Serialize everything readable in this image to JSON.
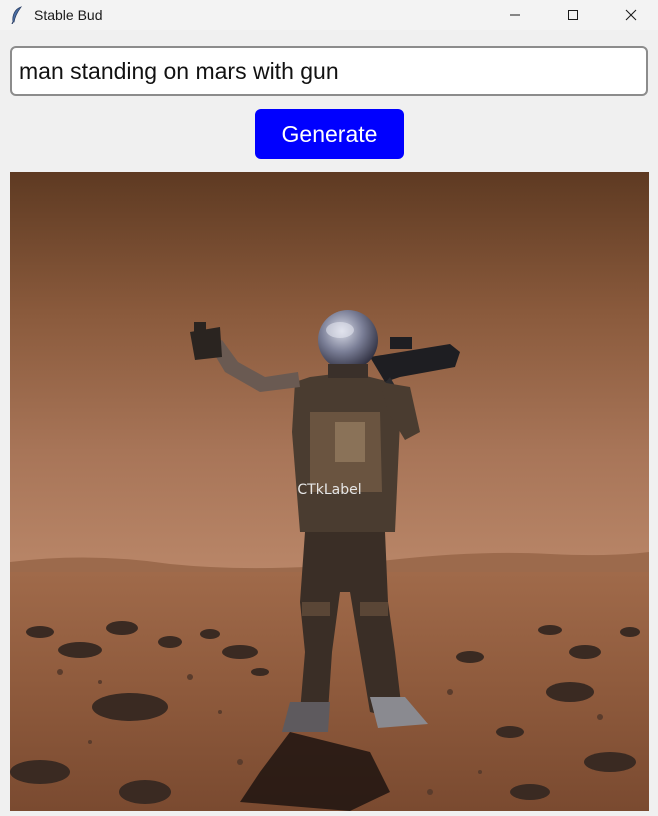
{
  "window": {
    "title": "Stable Bud",
    "icon": "feather-icon",
    "controls": [
      "minimize-icon",
      "maximize-icon",
      "close-icon"
    ]
  },
  "prompt": {
    "value": "man standing on mars with gun",
    "placeholder": ""
  },
  "generate_button": {
    "label": "Generate",
    "color": "#0000ff"
  },
  "image_label": {
    "text": "CTkLabel"
  },
  "colors": {
    "background": "#f0f0f0",
    "accent": "#0000ff"
  }
}
